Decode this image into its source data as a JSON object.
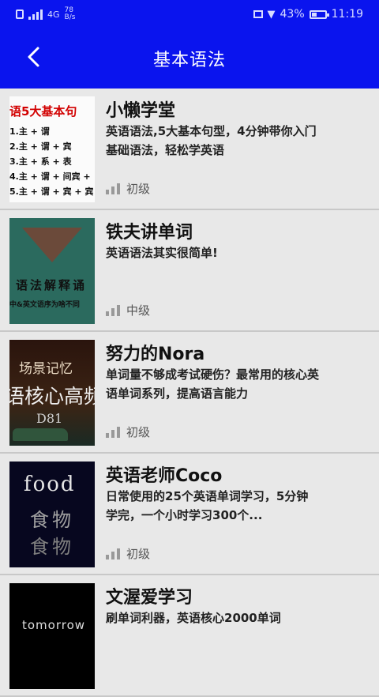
{
  "status": {
    "carrier_left": "4G",
    "net_speed": "78 B/s",
    "battery_percent_label": "43%",
    "battery_level": 0.43,
    "time": "11:19"
  },
  "header": {
    "title": "基本语法",
    "back_icon": "chevron-left-icon",
    "bar_color": "#0a14ee"
  },
  "courses": [
    {
      "title": "小懒学堂",
      "desc": "英语语法,5大基本句型，4分钟带你入门基础语法，轻松学英语",
      "level": "初级",
      "thumb": {
        "heading": "语5大基本句",
        "rows": [
          "1.主 + 谓",
          "2.主 + 谓 + 宾",
          "3.主 + 系 + 表",
          "4.主 + 谓 + 间宾 +",
          "5.主 + 谓 + 宾 + 宾"
        ]
      }
    },
    {
      "title": "铁夫讲单词",
      "desc": "英语语法其实很简单!",
      "level": "中级",
      "thumb": {
        "line1": "语法解释诵",
        "line2": "中&英文语序为啥不同"
      }
    },
    {
      "title": "努力的Nora",
      "desc": "单词量不够成考试硬伤？最常用的核心英语单词系列，提高语言能力",
      "level": "初级",
      "thumb": {
        "line1": "场景记忆",
        "line2": "语核心高频",
        "line3": "D81"
      }
    },
    {
      "title": "英语老师Coco",
      "desc": "日常使用的25个英语单词学习，5分钟学完，一个小时学习300个...",
      "level": "初级",
      "thumb": {
        "line1": "food",
        "line2": "食物",
        "line3": "食物"
      }
    },
    {
      "title": "文渥爱学习",
      "desc": "刷单词利器，英语核心2000单词",
      "level": "",
      "thumb": {
        "line1": "tomorrow"
      }
    }
  ]
}
